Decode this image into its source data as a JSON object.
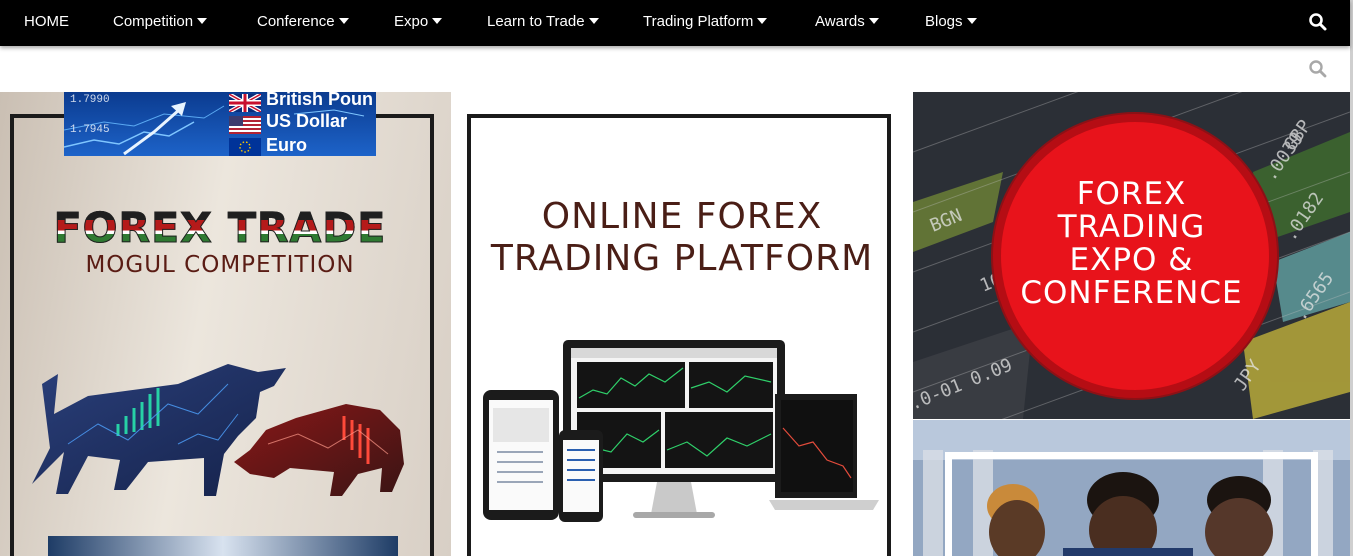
{
  "nav": {
    "items": [
      {
        "label": "HOME",
        "has_dropdown": false
      },
      {
        "label": "Competition",
        "has_dropdown": true
      },
      {
        "label": "Conference",
        "has_dropdown": true
      },
      {
        "label": "Expo",
        "has_dropdown": true
      },
      {
        "label": "Learn to Trade",
        "has_dropdown": true
      },
      {
        "label": "Trading Platform",
        "has_dropdown": true
      },
      {
        "label": "Awards",
        "has_dropdown": true
      },
      {
        "label": "Blogs",
        "has_dropdown": true
      }
    ],
    "search_icon": "search-icon"
  },
  "search_strip": {
    "search_icon": "search-icon"
  },
  "tiles": {
    "competition": {
      "banner": {
        "ticks": [
          "1.7990",
          "1.7945"
        ],
        "currencies": [
          "British Poun",
          "US Dollar",
          "Euro"
        ]
      },
      "title_line1": "FOREX TRADE",
      "title_line2": "MOGUL COMPETITION"
    },
    "platform": {
      "title_line1": "ONLINE FOREX",
      "title_line2": "TRADING PLATFORM"
    },
    "expo": {
      "lines": [
        "FOREX",
        "TRADING",
        "EXPO &",
        "CONFERENCE"
      ]
    }
  },
  "colors": {
    "nav_bg": "#000000",
    "expo_red": "#e8131b",
    "title_brown": "#4a1e16"
  }
}
